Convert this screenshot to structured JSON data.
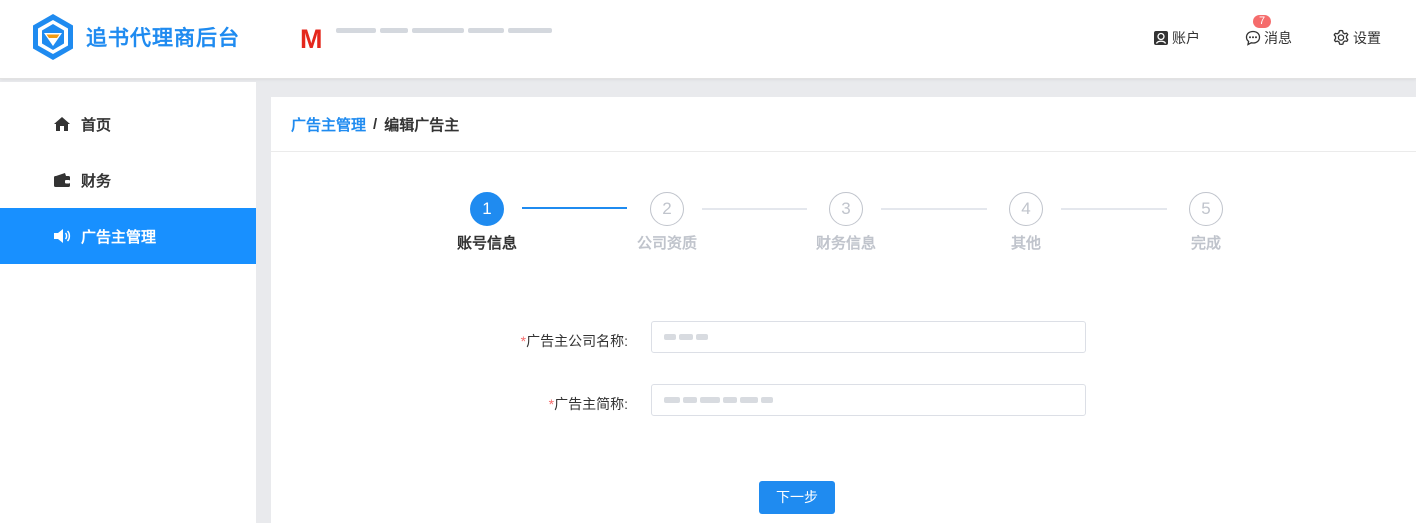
{
  "header": {
    "app_title": "追书代理商后台",
    "brand_letter": "M",
    "account_label": "账户",
    "messages_label": "消息",
    "messages_count": "7",
    "settings_label": "设置"
  },
  "sidebar": {
    "items": [
      {
        "label": "首页",
        "icon": "home-icon"
      },
      {
        "label": "财务",
        "icon": "wallet-icon"
      },
      {
        "label": "广告主管理",
        "icon": "megaphone-icon",
        "active": true
      }
    ]
  },
  "breadcrumb": {
    "parent": "广告主管理",
    "separator": "/",
    "current": "编辑广告主"
  },
  "steps": [
    {
      "number": "1",
      "label": "账号信息",
      "active": true
    },
    {
      "number": "2",
      "label": "公司资质"
    },
    {
      "number": "3",
      "label": "财务信息"
    },
    {
      "number": "4",
      "label": "其他"
    },
    {
      "number": "5",
      "label": "完成"
    }
  ],
  "form": {
    "required_mark": "*",
    "company_name_label": "广告主公司名称:",
    "short_name_label": "广告主简称:"
  },
  "next_button": "下一步",
  "colors": {
    "primary": "#1f8bf0",
    "sidebar_active": "#1890ff",
    "brand_red": "#e4271c",
    "badge": "#f56c6c"
  }
}
